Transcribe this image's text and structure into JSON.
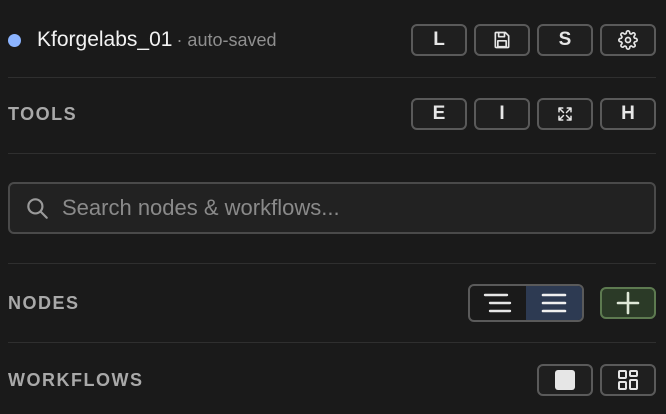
{
  "header": {
    "project_name": "Kforgelabs_01",
    "autosave_status": "· auto-saved",
    "buttons": {
      "l_label": "L",
      "s_label": "S"
    }
  },
  "tools": {
    "title": "TOOLS",
    "buttons": {
      "e_label": "E",
      "i_label": "I",
      "h_label": "H"
    }
  },
  "search": {
    "placeholder": "Search nodes & workflows..."
  },
  "nodes": {
    "title": "NODES",
    "view_modes": [
      "align-left",
      "align-justify"
    ],
    "active_view": "align-justify"
  },
  "workflows": {
    "title": "WORKFLOWS"
  },
  "colors": {
    "status_dot": "#8cb4ff",
    "active_toggle": "#2d3a52",
    "add_button": "#2b3a27"
  },
  "icons": {
    "save": "save-icon",
    "settings": "gear-icon",
    "fit": "arrows-fit-icon",
    "search": "search-icon",
    "add": "plus-icon",
    "square": "square-icon",
    "grid": "grid-icon"
  }
}
